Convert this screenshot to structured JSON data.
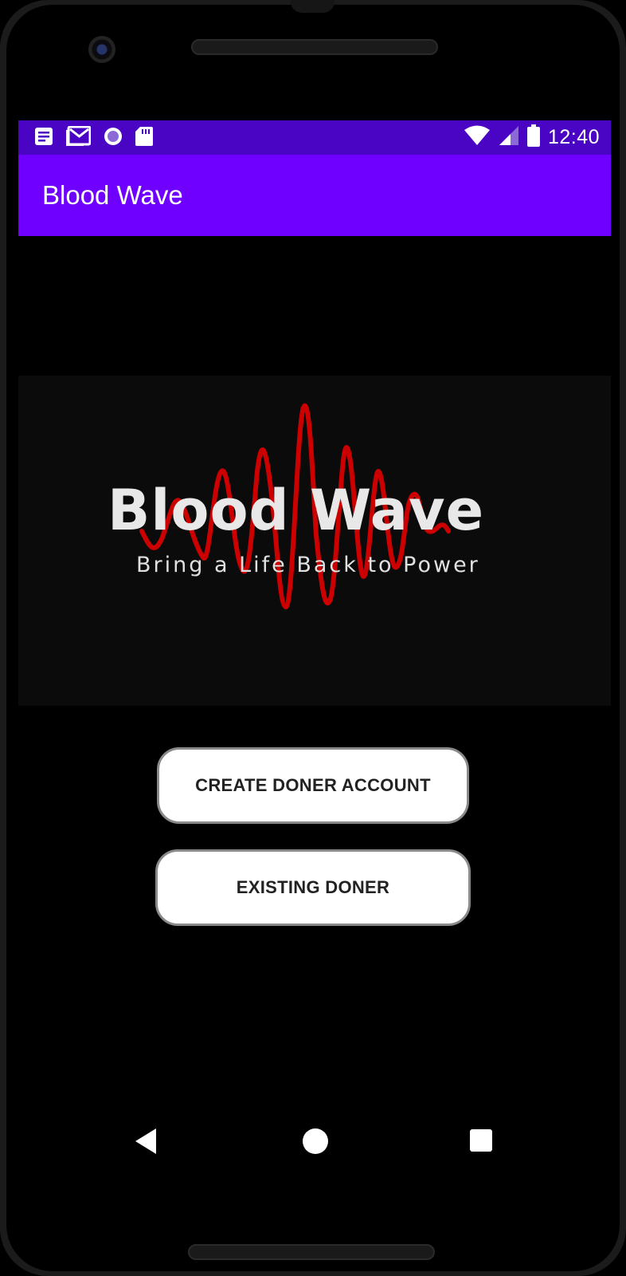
{
  "status_bar": {
    "time": "12:40",
    "left_icons": [
      "notes-icon",
      "gmail-icon",
      "record-icon",
      "sd-card-icon"
    ],
    "right_icons": [
      "wifi-icon",
      "cell-signal-icon",
      "battery-icon"
    ],
    "color": "#4a04c4"
  },
  "app_bar": {
    "title": "Blood Wave",
    "color": "#6f00ff"
  },
  "logo": {
    "title": "Blood Wave",
    "tagline": "Bring a Life Back to Power",
    "wave_color": "#cc0000"
  },
  "buttons": {
    "create_label": "CREATE DONER ACCOUNT",
    "existing_label": "EXISTING DONER"
  },
  "nav": {
    "back_icon": "back-triangle-icon",
    "home_icon": "home-circle-icon",
    "recent_icon": "recent-square-icon"
  }
}
